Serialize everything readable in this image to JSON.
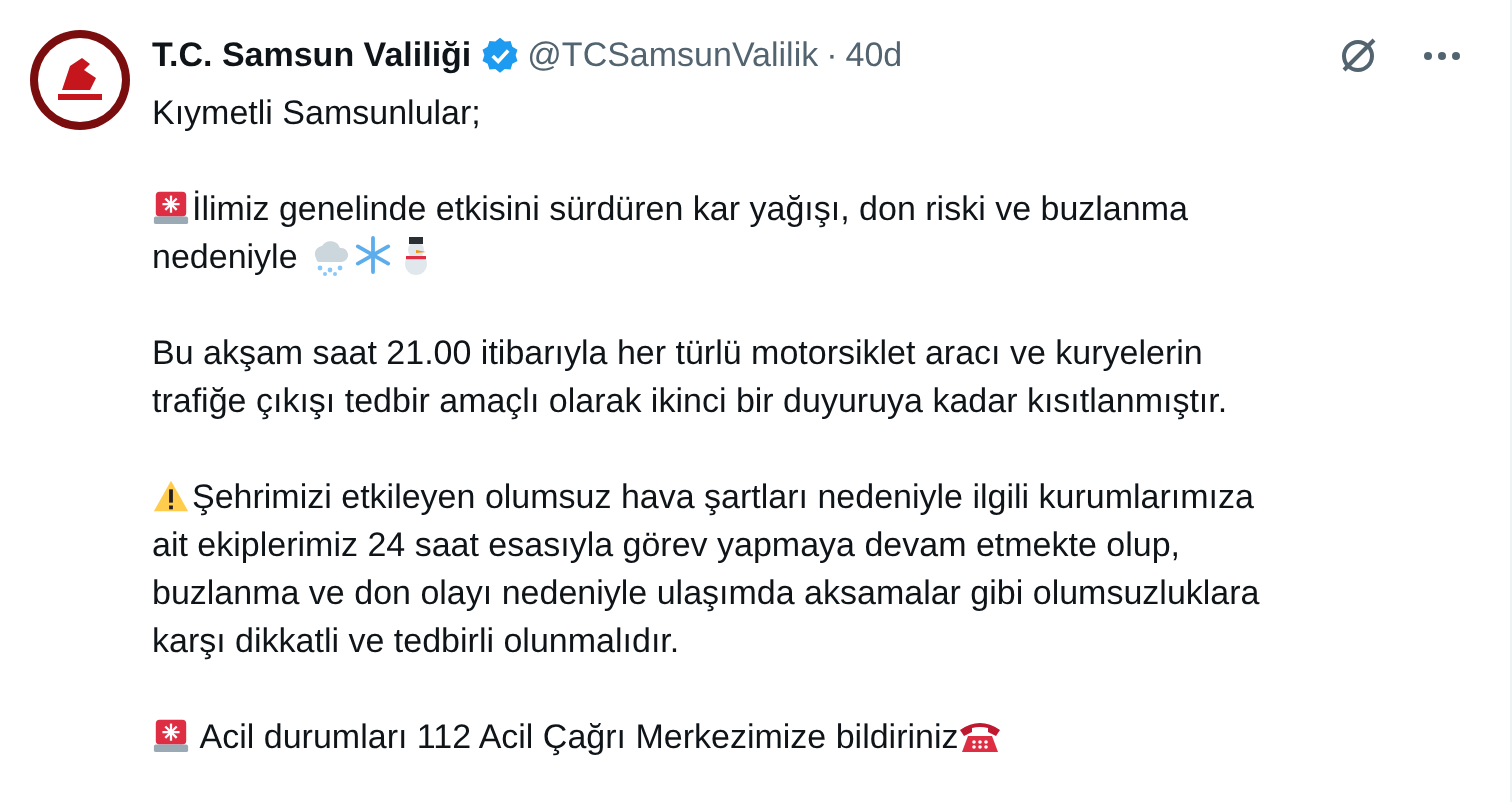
{
  "author": {
    "name": "T.C. Samsun Valiliği",
    "verified": true,
    "handle": "@TCSamsunValilik",
    "separator": "·",
    "time": "40d"
  },
  "paragraphs": [
    {
      "kind": "plain",
      "lines": [
        "Kıymetli Samsunlular;"
      ]
    },
    {
      "kind": "siren-weather",
      "lines": [
        "İlimiz genelinde etkisini sürdüren kar yağışı, don riski ve buzlanma",
        "nedeniyle"
      ]
    },
    {
      "kind": "plain",
      "lines": [
        "Bu akşam saat 21.00 itibarıyla her türlü motorsiklet aracı ve kuryelerin",
        "trafiğe çıkışı tedbir amaçlı olarak ikinci bir duyuruya kadar kısıtlanmıştır."
      ]
    },
    {
      "kind": "warning",
      "lines": [
        "Şehrimizi etkileyen olumsuz hava şartları nedeniyle ilgili kurumlarımıza",
        "ait ekiplerimiz 24 saat esasıyla görev yapmaya devam etmekte olup,",
        "buzlanma ve don olayı nedeniyle ulaşımda aksamalar gibi olumsuzluklara",
        "karşı dikkatli ve tedbirli olunmalıdır."
      ]
    },
    {
      "kind": "siren-phone",
      "lines": [
        " Acil durumları 112 Acil Çağrı Merkezimize bildiriniz"
      ]
    }
  ]
}
